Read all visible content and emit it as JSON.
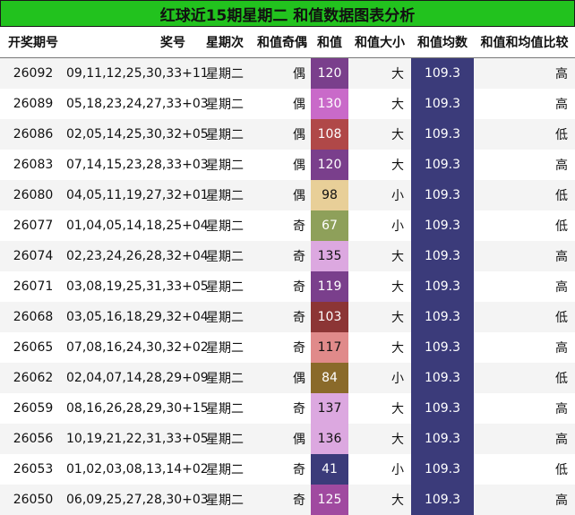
{
  "title": "红球近15期星期二 和值数据图表分析",
  "headers": {
    "issue": "开奖期号",
    "numbers": "奖号",
    "weekday": "星期次",
    "odd_even": "和值奇偶",
    "sum": "和值",
    "size": "和值大小",
    "avg": "和值均数",
    "compare": "和值和均值比较"
  },
  "colors": {
    "title_bg": "#22c21e",
    "avg_bg": "#3b3b7a"
  },
  "rows": [
    {
      "issue": "26092",
      "numbers": "09,11,12,25,30,33+11",
      "weekday": "星期二",
      "odd_even": "偶",
      "sum": "120",
      "sum_color": "#7a3f8c",
      "size": "大",
      "avg": "109.3",
      "compare": "高"
    },
    {
      "issue": "26089",
      "numbers": "05,18,23,24,27,33+03",
      "weekday": "星期二",
      "odd_even": "偶",
      "sum": "130",
      "sum_color": "#c96ac9",
      "size": "大",
      "avg": "109.3",
      "compare": "高"
    },
    {
      "issue": "26086",
      "numbers": "02,05,14,25,30,32+05",
      "weekday": "星期二",
      "odd_even": "偶",
      "sum": "108",
      "sum_color": "#b04848",
      "size": "大",
      "avg": "109.3",
      "compare": "低"
    },
    {
      "issue": "26083",
      "numbers": "07,14,15,23,28,33+03",
      "weekday": "星期二",
      "odd_even": "偶",
      "sum": "120",
      "sum_color": "#7a3f8c",
      "size": "大",
      "avg": "109.3",
      "compare": "高"
    },
    {
      "issue": "26080",
      "numbers": "04,05,11,19,27,32+01",
      "weekday": "星期二",
      "odd_even": "偶",
      "sum": "98",
      "sum_color": "#e8cf98",
      "sum_text": "#111111",
      "size": "小",
      "avg": "109.3",
      "compare": "低"
    },
    {
      "issue": "26077",
      "numbers": "01,04,05,14,18,25+04",
      "weekday": "星期二",
      "odd_even": "奇",
      "sum": "67",
      "sum_color": "#8ea05a",
      "size": "小",
      "avg": "109.3",
      "compare": "低"
    },
    {
      "issue": "26074",
      "numbers": "02,23,24,26,28,32+04",
      "weekday": "星期二",
      "odd_even": "奇",
      "sum": "135",
      "sum_color": "#dca8e0",
      "sum_text": "#111111",
      "size": "大",
      "avg": "109.3",
      "compare": "高"
    },
    {
      "issue": "26071",
      "numbers": "03,08,19,25,31,33+05",
      "weekday": "星期二",
      "odd_even": "奇",
      "sum": "119",
      "sum_color": "#7a3f8c",
      "size": "大",
      "avg": "109.3",
      "compare": "高"
    },
    {
      "issue": "26068",
      "numbers": "03,05,16,18,29,32+04",
      "weekday": "星期二",
      "odd_even": "奇",
      "sum": "103",
      "sum_color": "#8c3535",
      "size": "大",
      "avg": "109.3",
      "compare": "低"
    },
    {
      "issue": "26065",
      "numbers": "07,08,16,24,30,32+02",
      "weekday": "星期二",
      "odd_even": "奇",
      "sum": "117",
      "sum_color": "#e08a8a",
      "sum_text": "#111111",
      "size": "大",
      "avg": "109.3",
      "compare": "高"
    },
    {
      "issue": "26062",
      "numbers": "02,04,07,14,28,29+09",
      "weekday": "星期二",
      "odd_even": "偶",
      "sum": "84",
      "sum_color": "#8a6a2a",
      "size": "小",
      "avg": "109.3",
      "compare": "低"
    },
    {
      "issue": "26059",
      "numbers": "08,16,26,28,29,30+15",
      "weekday": "星期二",
      "odd_even": "奇",
      "sum": "137",
      "sum_color": "#dca8e0",
      "sum_text": "#111111",
      "size": "大",
      "avg": "109.3",
      "compare": "高"
    },
    {
      "issue": "26056",
      "numbers": "10,19,21,22,31,33+05",
      "weekday": "星期二",
      "odd_even": "偶",
      "sum": "136",
      "sum_color": "#dca8e0",
      "sum_text": "#111111",
      "size": "大",
      "avg": "109.3",
      "compare": "高"
    },
    {
      "issue": "26053",
      "numbers": "01,02,03,08,13,14+02",
      "weekday": "星期二",
      "odd_even": "奇",
      "sum": "41",
      "sum_color": "#3b3b7a",
      "size": "小",
      "avg": "109.3",
      "compare": "低"
    },
    {
      "issue": "26050",
      "numbers": "06,09,25,27,28,30+03",
      "weekday": "星期二",
      "odd_even": "奇",
      "sum": "125",
      "sum_color": "#a04aa0",
      "size": "大",
      "avg": "109.3",
      "compare": "高"
    }
  ]
}
